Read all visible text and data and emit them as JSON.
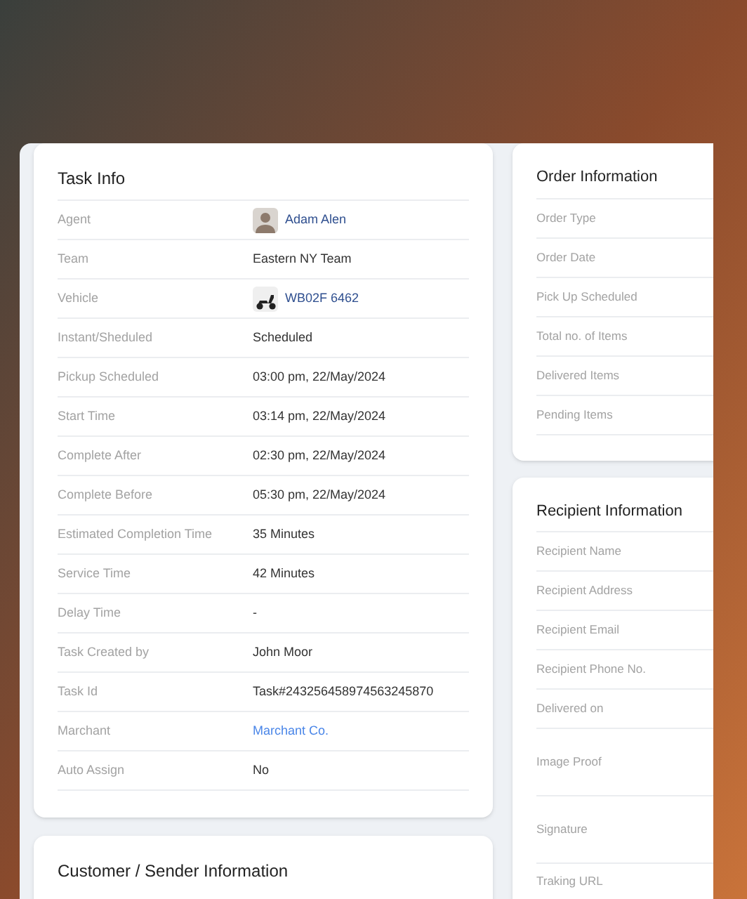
{
  "task_info": {
    "title": "Task Info",
    "rows": [
      {
        "label": "Agent",
        "value": "Adam Alen",
        "kind": "person"
      },
      {
        "label": "Team",
        "value": "Eastern NY Team",
        "kind": "text"
      },
      {
        "label": "Vehicle",
        "value": "WB02F 6462",
        "kind": "vehicle"
      },
      {
        "label": "Instant/Sheduled",
        "value": "Scheduled",
        "kind": "text"
      },
      {
        "label": "Pickup Scheduled",
        "value": "03:00 pm, 22/May/2024",
        "kind": "text"
      },
      {
        "label": "Start Time",
        "value": "03:14 pm, 22/May/2024",
        "kind": "text"
      },
      {
        "label": "Complete After",
        "value": "02:30 pm, 22/May/2024",
        "kind": "text"
      },
      {
        "label": "Complete Before",
        "value": "05:30 pm, 22/May/2024",
        "kind": "text"
      },
      {
        "label": "Estimated Completion Time",
        "value": "35 Minutes",
        "kind": "text"
      },
      {
        "label": "Service Time",
        "value": "42 Minutes",
        "kind": "text"
      },
      {
        "label": "Delay Time",
        "value": "-",
        "kind": "text"
      },
      {
        "label": "Task Created by",
        "value": "John Moor",
        "kind": "text"
      },
      {
        "label": "Task Id",
        "value": "Task#243256458974563245870",
        "kind": "text"
      },
      {
        "label": "Marchant",
        "value": "Marchant Co.",
        "kind": "link"
      },
      {
        "label": "Auto Assign",
        "value": "No",
        "kind": "text"
      }
    ]
  },
  "customer_info": {
    "title": "Customer / Sender Information"
  },
  "order_info": {
    "title": "Order Information",
    "rows": [
      {
        "label": "Order Type"
      },
      {
        "label": "Order Date"
      },
      {
        "label": "Pick Up Scheduled"
      },
      {
        "label": "Total no. of Items"
      },
      {
        "label": "Delivered Items"
      },
      {
        "label": "Pending Items"
      }
    ]
  },
  "recipient_info": {
    "title": "Recipient Information",
    "rows": [
      {
        "label": "Recipient Name",
        "kind": "text"
      },
      {
        "label": "Recipient Address",
        "kind": "text"
      },
      {
        "label": "Recipient Email",
        "kind": "text"
      },
      {
        "label": "Recipient Phone No.",
        "kind": "text"
      },
      {
        "label": "Delivered on",
        "kind": "text"
      },
      {
        "label": "Image Proof",
        "kind": "tall"
      },
      {
        "label": "Signature",
        "kind": "tall"
      },
      {
        "label": "Traking URL",
        "kind": "last"
      }
    ]
  }
}
